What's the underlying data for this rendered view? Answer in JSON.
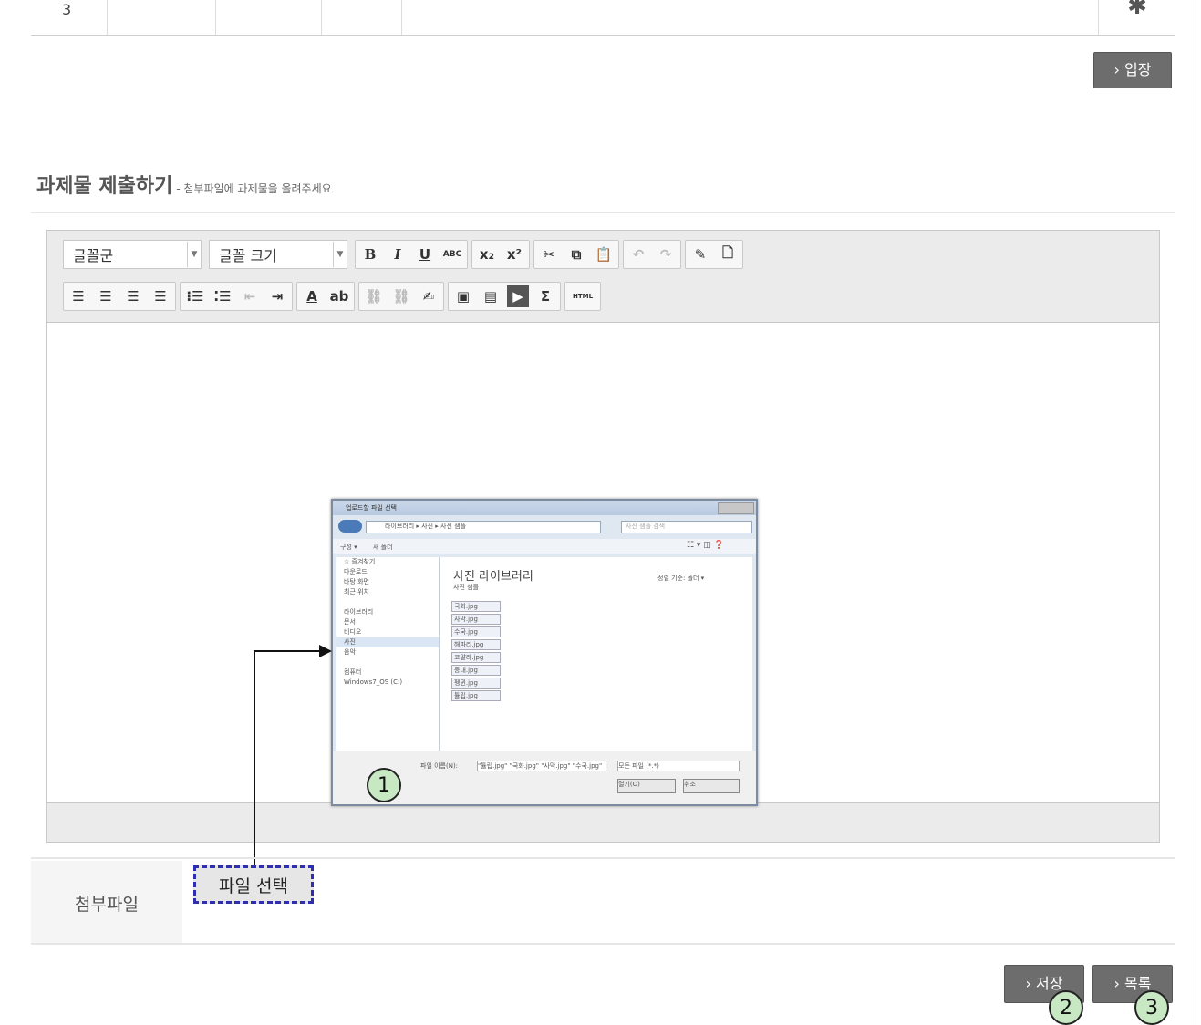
{
  "top_table": {
    "row_number": "3"
  },
  "enter_button": "› 입장",
  "section": {
    "title": "과제물 제출하기",
    "subtitle": "- 첨부파일에 과제물을 올려주세요"
  },
  "editor": {
    "font_select": "글꼴군",
    "size_select": "글꼴 크기",
    "row1_buttons": [
      "B",
      "I",
      "U",
      "ABC",
      "x₂",
      "x²"
    ],
    "html_button": "HTML",
    "sigma": "Σ"
  },
  "file_dialog": {
    "title": "업로드할 파일 선택",
    "path": "라이브러리 ▸ 사진 ▸ 사진 샘플",
    "search_placeholder": "사진 샘플 검색",
    "organize": "구성 ▾",
    "new_folder": "새 폴더",
    "library_title": "사진 라이브러리",
    "library_subtitle": "사진 샘플",
    "arrange": "정렬 기준: 폴더 ▾",
    "nav_items": [
      "☆ 즐겨찾기",
      "다운로드",
      "바탕 화면",
      "최근 위치",
      "",
      "라이브러리",
      "문서",
      "비디오",
      "사진",
      "음악",
      "",
      "컴퓨터",
      "Windows7_OS (C:)"
    ],
    "files": [
      "국화.jpg",
      "사막.jpg",
      "수국.jpg",
      "해파리.jpg",
      "코알라.jpg",
      "등대.jpg",
      "펭귄.jpg",
      "튤립.jpg"
    ],
    "filename_label": "파일 이름(N):",
    "filename_value": "\"튤립.jpg\" \"국화.jpg\" \"사막.jpg\" \"수국.jpg\"",
    "filetype": "모든 파일 (*.*)",
    "open_label": "열기(O)",
    "cancel_label": "취소"
  },
  "attachment": {
    "label": "첨부파일",
    "file_button": "파일 선택"
  },
  "save_button": "› 저장",
  "list_button": "› 목록",
  "markers": [
    "1",
    "2",
    "3"
  ]
}
